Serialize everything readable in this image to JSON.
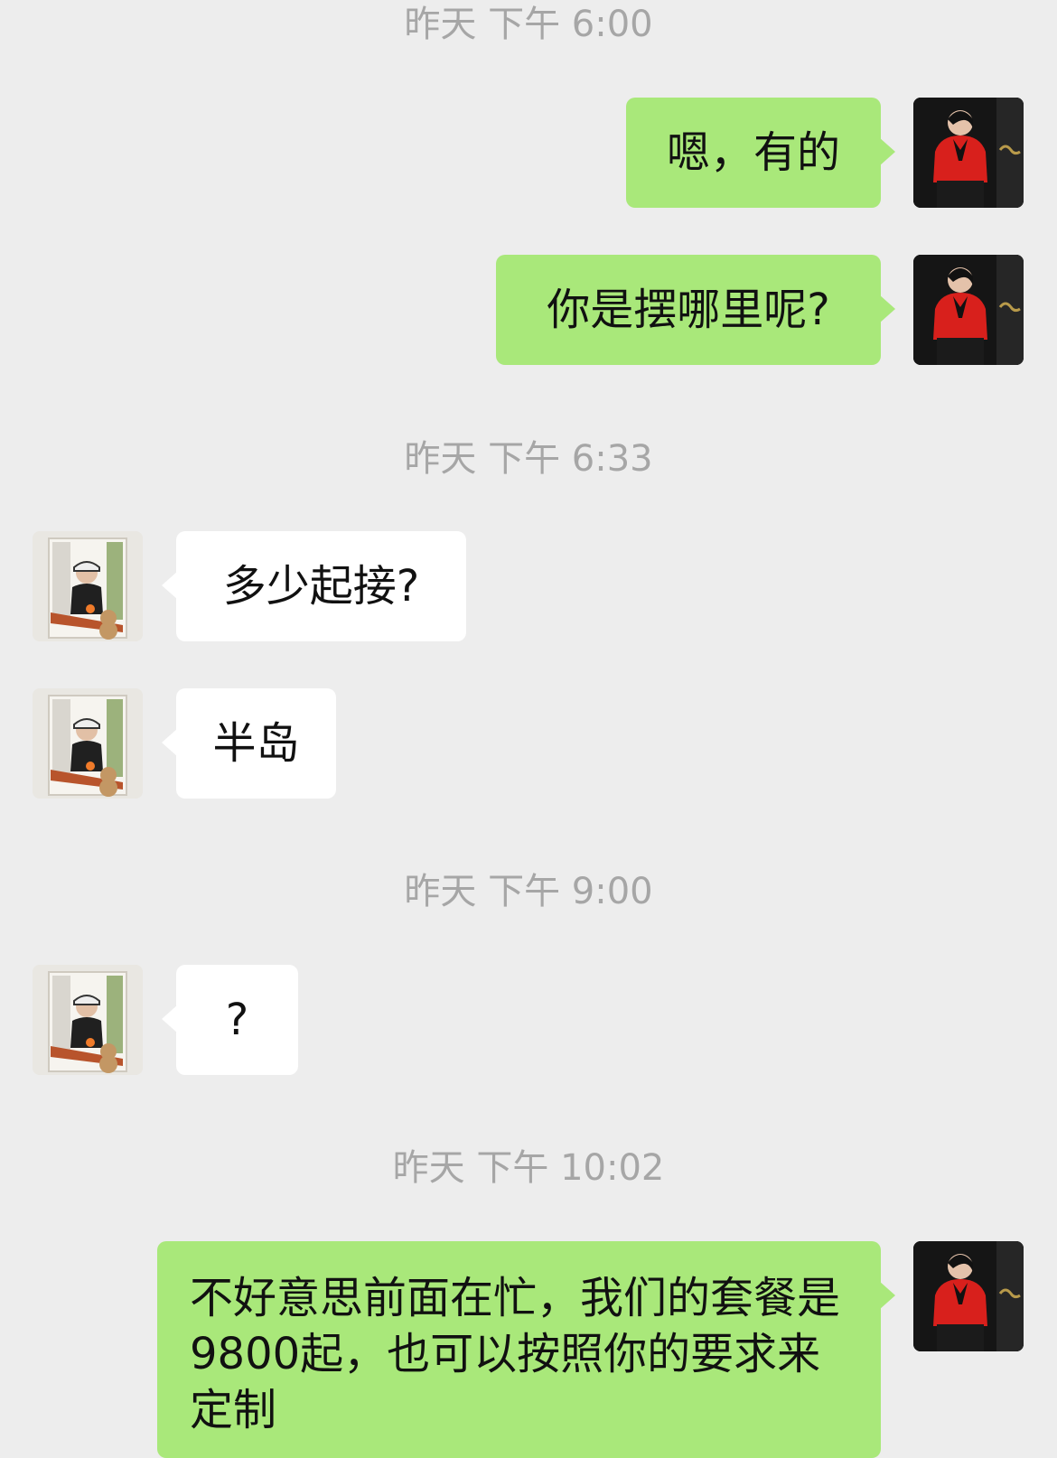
{
  "timestamps": [
    "昨天 下午 6:00",
    "昨天 下午 6:33",
    "昨天 下午 9:00",
    "昨天 下午 10:02"
  ],
  "messages": [
    {
      "sender": "me",
      "text": "嗯，有的"
    },
    {
      "sender": "me",
      "text": "你是摆哪里呢?"
    },
    {
      "sender": "other",
      "text": "多少起接?"
    },
    {
      "sender": "other",
      "text": "半岛"
    },
    {
      "sender": "other",
      "text": "?"
    },
    {
      "sender": "me",
      "text": "不好意思前面在忙，我们的套餐是9800起，也可以按照你的要求来定制"
    }
  ],
  "colors": {
    "background": "#ededed",
    "my_bubble": "#a9e87a",
    "their_bubble": "#ffffff",
    "timestamp": "#a6a6a6"
  }
}
